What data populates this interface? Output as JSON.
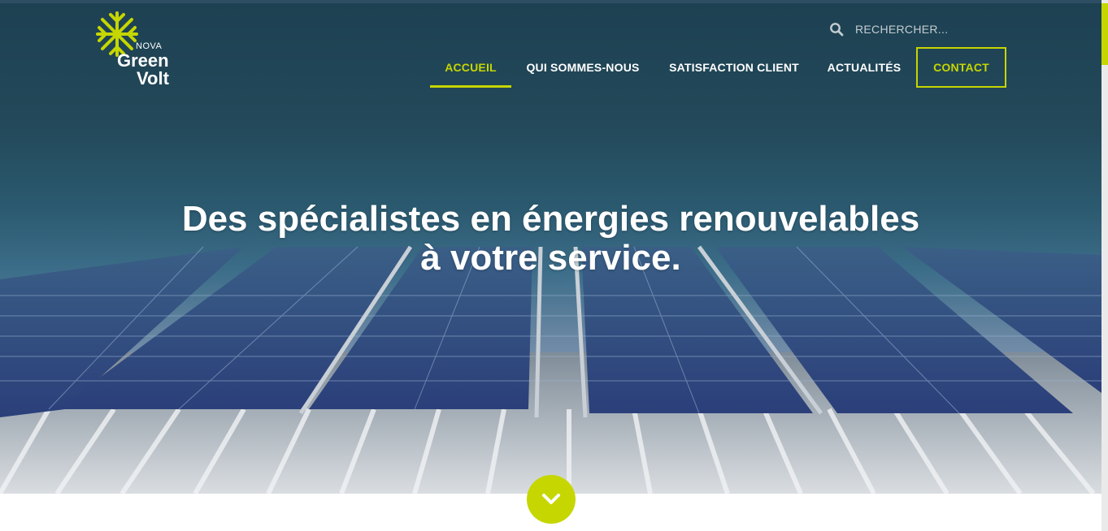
{
  "header": {
    "logo": {
      "small": "NOVA",
      "line1": "Green",
      "line2": "Volt"
    },
    "search": {
      "placeholder": "RECHERCHER...",
      "icon": "search-icon"
    },
    "nav": [
      {
        "label": "ACCUEIL",
        "active": true
      },
      {
        "label": "QUI SOMMES-NOUS",
        "active": false
      },
      {
        "label": "SATISFACTION CLIENT",
        "active": false
      },
      {
        "label": "ACTUALITÉS",
        "active": false
      },
      {
        "label": "CONTACT",
        "active": false
      }
    ]
  },
  "hero": {
    "title_line1": "Des spécialistes en énergies renouvelables",
    "title_line2": "à votre service.",
    "scroll_icon": "chevron-down-icon"
  },
  "colors": {
    "accent": "#c6d600",
    "header_bg": "#1d4152",
    "white": "#ffffff"
  }
}
